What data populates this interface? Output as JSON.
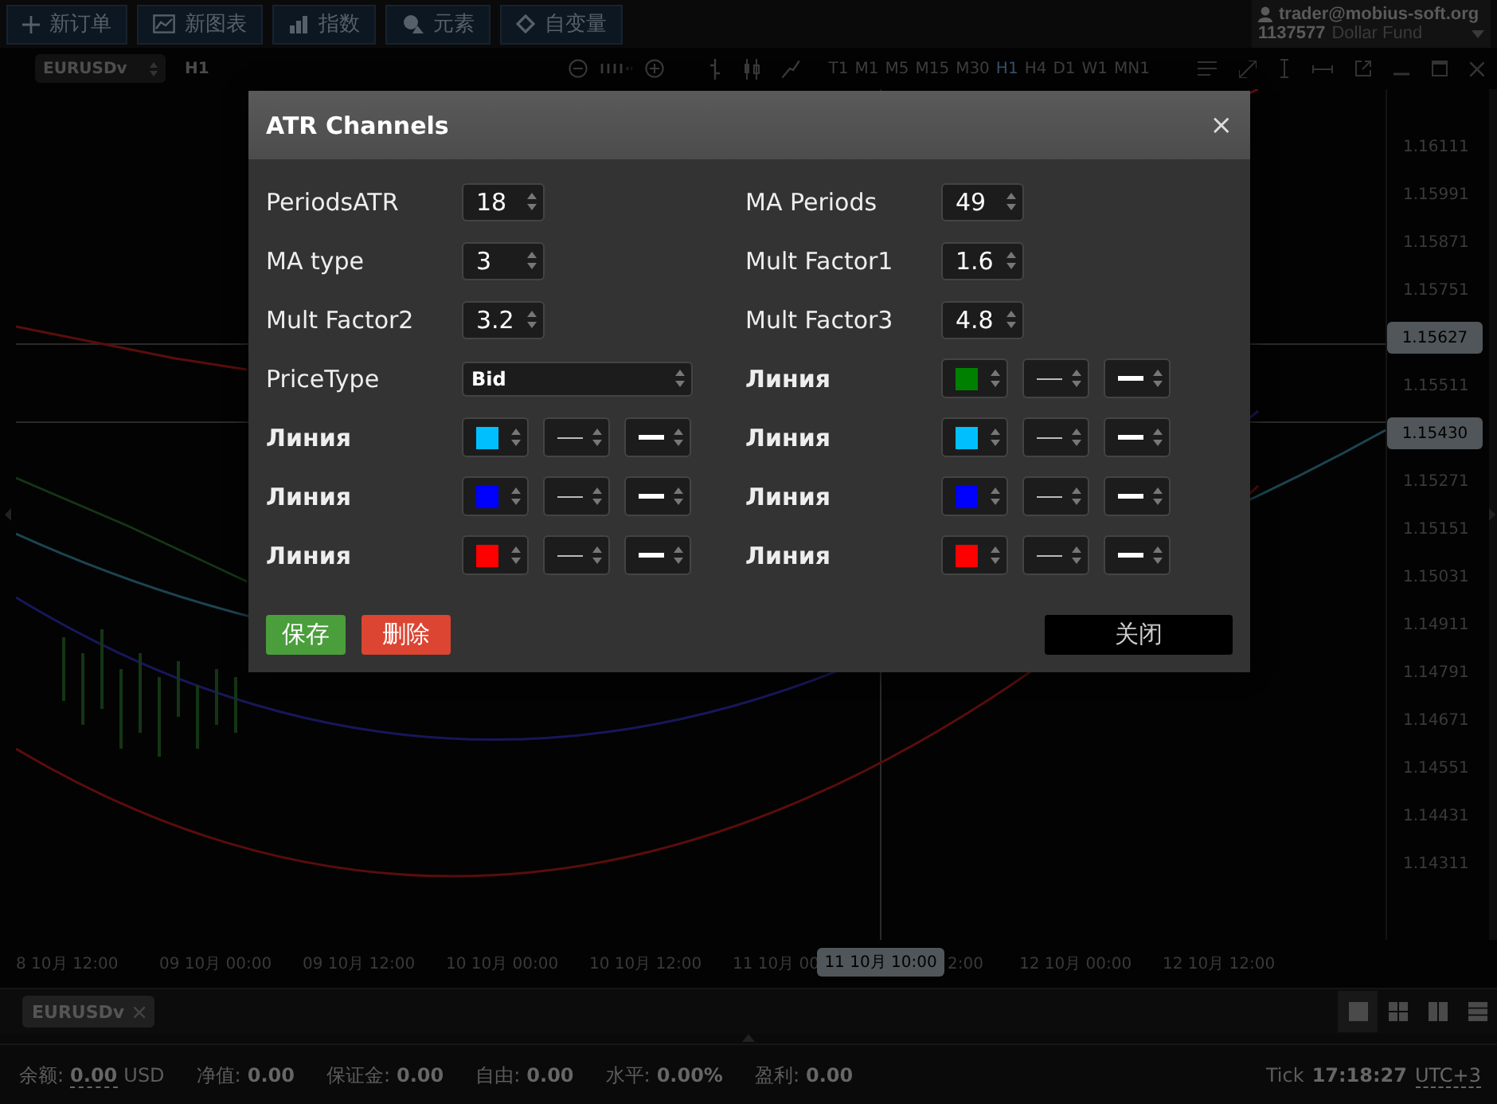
{
  "toolbar": {
    "buttons": [
      {
        "kind": "new_order",
        "label": "新订单"
      },
      {
        "kind": "new_chart",
        "label": "新图表"
      },
      {
        "kind": "indicators",
        "label": "指数"
      },
      {
        "kind": "objects",
        "label": "元素"
      },
      {
        "kind": "variables",
        "label": "自变量"
      }
    ]
  },
  "account": {
    "email": "trader@mobius-soft.org",
    "number": "1137577",
    "name": "Dollar Fund"
  },
  "chart": {
    "symbol": "EURUSDv",
    "period": "H1",
    "timeframes": [
      {
        "label": "T1",
        "selected": false
      },
      {
        "label": "M1",
        "selected": false
      },
      {
        "label": "M5",
        "selected": false
      },
      {
        "label": "M15",
        "selected": false
      },
      {
        "label": "M30",
        "selected": false
      },
      {
        "label": "H1",
        "selected": true
      },
      {
        "label": "H4",
        "selected": false
      },
      {
        "label": "D1",
        "selected": false
      },
      {
        "label": "W1",
        "selected": false
      },
      {
        "label": "MN1",
        "selected": false
      }
    ],
    "price_axis": [
      {
        "kind": "tick",
        "label": "1.16111"
      },
      {
        "kind": "tick",
        "label": "1.15991"
      },
      {
        "kind": "tick",
        "label": "1.15871"
      },
      {
        "kind": "tick",
        "label": "1.15751"
      },
      {
        "kind": "tag",
        "label": "1.15627"
      },
      {
        "kind": "tick",
        "label": "1.15511"
      },
      {
        "kind": "tag",
        "label": "1.15430"
      },
      {
        "kind": "tick",
        "label": "1.15271"
      },
      {
        "kind": "tick",
        "label": "1.15151"
      },
      {
        "kind": "tick",
        "label": "1.15031"
      },
      {
        "kind": "tick",
        "label": "1.14911"
      },
      {
        "kind": "tick",
        "label": "1.14791"
      },
      {
        "kind": "tick",
        "label": "1.14671"
      },
      {
        "kind": "tick",
        "label": "1.14551"
      },
      {
        "kind": "tick",
        "label": "1.14431"
      },
      {
        "kind": "tick",
        "label": "1.14311"
      }
    ],
    "time_axis": [
      {
        "kind": "tick",
        "label": "8 10月 12:00"
      },
      {
        "kind": "tick",
        "label": "09 10月 00:00"
      },
      {
        "kind": "tick",
        "label": "09 10月 12:00"
      },
      {
        "kind": "tick",
        "label": "10 10月 00:00"
      },
      {
        "kind": "tick",
        "label": "10 10月 12:00"
      },
      {
        "kind": "tick",
        "label": "11 10月 00"
      },
      {
        "kind": "partial",
        "label": "2:00"
      },
      {
        "kind": "tick",
        "label": "12 10月 00:00"
      },
      {
        "kind": "tick",
        "label": "12 10月 12:00"
      }
    ],
    "crosshair_time": "11 10月 10:00"
  },
  "dialog": {
    "title": "ATR Channels",
    "close": "×",
    "params": [
      {
        "kind": "number",
        "label": "PeriodsATR",
        "value": "18"
      },
      {
        "kind": "number",
        "label": "MA Periods",
        "value": "49"
      },
      {
        "kind": "number",
        "label": "MA type",
        "value": "3"
      },
      {
        "kind": "number",
        "label": "Mult Factor1",
        "value": "1.6"
      },
      {
        "kind": "number",
        "label": "Mult Factor2",
        "value": "3.2"
      },
      {
        "kind": "number",
        "label": "Mult Factor3",
        "value": "4.8"
      },
      {
        "kind": "select",
        "label": "PriceType",
        "value": "Bid"
      },
      {
        "kind": "line",
        "label": "Линия",
        "color": "#008000"
      },
      {
        "kind": "line",
        "label": "Линия",
        "color": "#00bfff"
      },
      {
        "kind": "line",
        "label": "Линия",
        "color": "#00bfff"
      },
      {
        "kind": "line",
        "label": "Линия",
        "color": "#0000ff"
      },
      {
        "kind": "line",
        "label": "Линия",
        "color": "#0000ff"
      },
      {
        "kind": "line",
        "label": "Линия",
        "color": "#ff0000"
      },
      {
        "kind": "line",
        "label": "Линия",
        "color": "#ff0000"
      }
    ],
    "buttons": [
      {
        "kind": "save",
        "label": "保存"
      },
      {
        "kind": "delete",
        "label": "删除"
      },
      {
        "kind": "close",
        "label": "关闭"
      }
    ]
  },
  "tabs": [
    {
      "label": "EURUSDv",
      "selected": true
    }
  ],
  "layouts": [
    {
      "kind": "single",
      "selected": true
    },
    {
      "kind": "grid",
      "selected": false
    },
    {
      "kind": "columns",
      "selected": false
    },
    {
      "kind": "rows",
      "selected": false
    }
  ],
  "status": {
    "items": [
      {
        "label": "余额:",
        "value": "0.00",
        "unit": "USD",
        "linked": true
      },
      {
        "label": "净值:",
        "value": "0.00",
        "linked": false
      },
      {
        "label": "保证金:",
        "value": "0.00",
        "linked": false
      },
      {
        "label": "自由:",
        "value": "0.00",
        "linked": false
      },
      {
        "label": "水平:",
        "value": "0.00%",
        "linked": false
      },
      {
        "label": "盈利:",
        "value": "0.00",
        "linked": false
      }
    ],
    "tick_label": "Tick",
    "tick_time": "17:18:27",
    "timezone": "UTC+3"
  }
}
